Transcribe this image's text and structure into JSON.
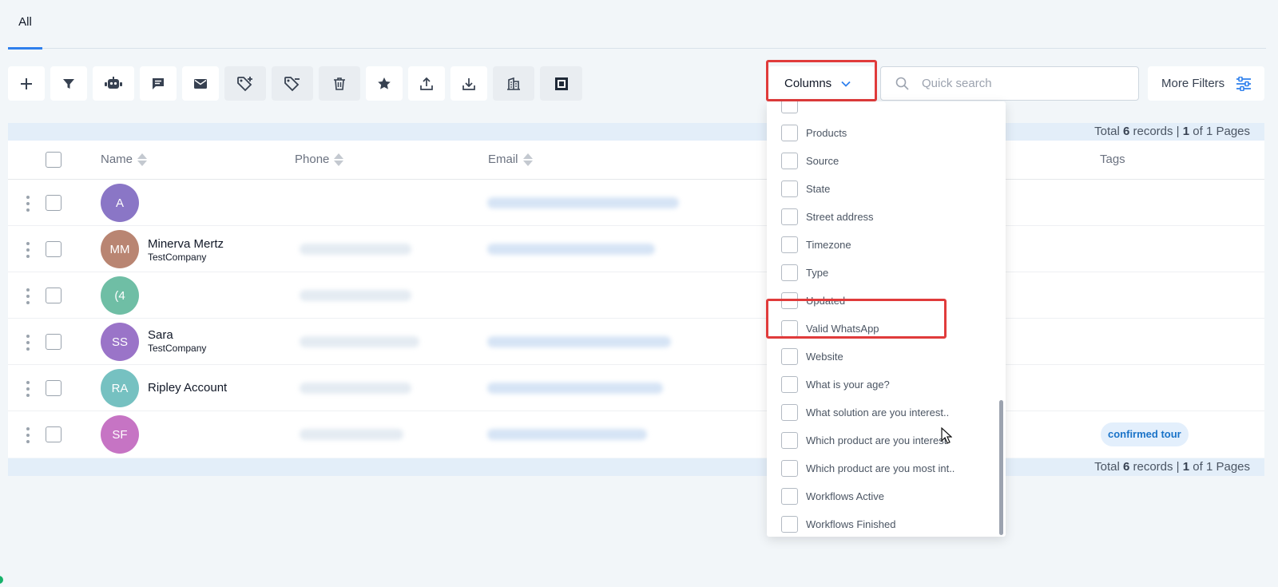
{
  "tabs": [
    {
      "label": "All",
      "active": true
    }
  ],
  "toolbar": {
    "buttons": [
      {
        "name": "add-button",
        "icon": "plus-icon"
      },
      {
        "name": "filter-button",
        "icon": "filter-icon"
      },
      {
        "name": "automation-button",
        "icon": "robot-icon"
      },
      {
        "name": "sms-button",
        "icon": "message-icon"
      },
      {
        "name": "email-button",
        "icon": "mail-icon"
      },
      {
        "name": "add-tag-button",
        "icon": "tag-plus-icon"
      },
      {
        "name": "remove-tag-button",
        "icon": "tag-minus-icon"
      },
      {
        "name": "delete-button",
        "icon": "trash-icon"
      },
      {
        "name": "review-button",
        "icon": "star-icon"
      },
      {
        "name": "export-button",
        "icon": "upload-icon"
      },
      {
        "name": "import-button",
        "icon": "download-icon"
      },
      {
        "name": "company-button",
        "icon": "building-icon"
      },
      {
        "name": "bulk-action-button",
        "icon": "frame-icon"
      }
    ]
  },
  "columns_button": {
    "label": "Columns"
  },
  "search": {
    "placeholder": "Quick search"
  },
  "more_filters": {
    "label": "More Filters"
  },
  "totals": {
    "prefix": "Total",
    "records": "6",
    "records_label": "records |",
    "page": "1",
    "of_label": "of 1 Pages"
  },
  "table": {
    "headers": {
      "name": "Name",
      "phone": "Phone",
      "email": "Email",
      "tags": "Tags"
    },
    "rows": [
      {
        "initials": "A",
        "color": "#8a76c6",
        "name": "",
        "company": "",
        "tag": ""
      },
      {
        "initials": "MM",
        "color": "#b98572",
        "name": "Minerva Mertz",
        "company": "TestCompany",
        "tag": ""
      },
      {
        "initials": "(4",
        "color": "#6fbea5",
        "name": "",
        "company": "",
        "tag": ""
      },
      {
        "initials": "SS",
        "color": "#9a74c8",
        "name": "Sara",
        "company": "TestCompany",
        "tag": ""
      },
      {
        "initials": "RA",
        "color": "#76c1c1",
        "name": "Ripley Account",
        "company": "",
        "tag": ""
      },
      {
        "initials": "SF",
        "color": "#c674c4",
        "name": "",
        "company": "",
        "tag": "confirmed tour"
      }
    ]
  },
  "columns_dropdown": {
    "items": [
      "Products",
      "Source",
      "State",
      "Street address",
      "Timezone",
      "Type",
      "Updated",
      "Valid WhatsApp",
      "Website",
      "What is your age?",
      "What solution are you interest..",
      "Which product are you interest",
      "Which product are you most int..",
      "Workflows Active",
      "Workflows Finished"
    ],
    "highlighted": "Valid WhatsApp"
  },
  "colors": {
    "accent": "#2f80ed",
    "highlight": "#e03b3b",
    "tag_text": "#1a73c8"
  }
}
